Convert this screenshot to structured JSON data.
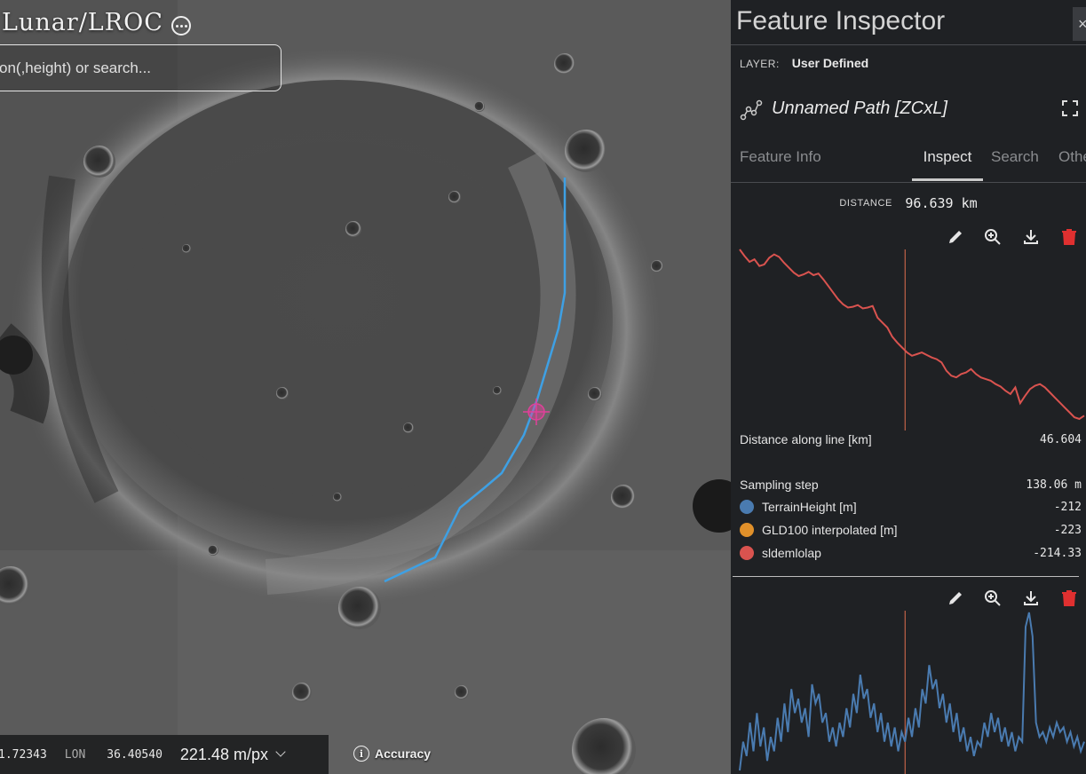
{
  "map": {
    "app_title": "Lunar/LROC",
    "search_placeholder": "on(,height) or search...",
    "lat_value": "1.72343",
    "lon_label": "LON",
    "lon_value": "36.40540",
    "scale": "221.48 m/px",
    "accuracy_label": "Accuracy",
    "path_color": "#3ea0e4",
    "marker_color": "#e0409a"
  },
  "panel": {
    "title": "Feature Inspector",
    "close_label": "×",
    "layer_key": "LAYER:",
    "layer_value": "User Defined",
    "feature_name": "Unnamed Path [ZCxL]",
    "tabs": [
      "Feature Info",
      "Inspect",
      "Search",
      "Othe"
    ],
    "active_tab": "Inspect",
    "distance_key": "DISTANCE",
    "distance_value": "96.639 km",
    "along_label": "Distance along line [km]",
    "along_value": "46.604",
    "sampling_label": "Sampling step",
    "sampling_value": "138.06 m",
    "legend": [
      {
        "label": "TerrainHeight [m]",
        "value": "-212",
        "color": "#4a7bb0"
      },
      {
        "label": "GLD100 interpolated [m]",
        "value": "-223",
        "color": "#e0902a"
      },
      {
        "label": "sldemlolap",
        "value": "-214.33",
        "color": "#d9534f"
      }
    ]
  },
  "chart_data": [
    {
      "type": "line",
      "series": [
        {
          "name": "sldemlolap",
          "color": "#d9534f",
          "values": [
            -120,
            -128,
            -135,
            -132,
            -140,
            -138,
            -130,
            -126,
            -129,
            -136,
            -142,
            -148,
            -152,
            -150,
            -147,
            -151,
            -149,
            -156,
            -164,
            -172,
            -180,
            -186,
            -190,
            -189,
            -187,
            -191,
            -190,
            -188,
            -202,
            -208,
            -214,
            -225,
            -232,
            -238,
            -244,
            -248,
            -246,
            -244,
            -247,
            -250,
            -252,
            -256,
            -266,
            -272,
            -274,
            -270,
            -268,
            -264,
            -270,
            -274,
            -276,
            -278,
            -282,
            -285,
            -290,
            -294,
            -286,
            -305,
            -296,
            -288,
            -284,
            -282,
            -286,
            -292,
            -298,
            -304,
            -310,
            -316,
            -322,
            -324,
            -320
          ]
        }
      ],
      "cursor_position_fraction": 0.48
    },
    {
      "type": "line",
      "series": [
        {
          "name": "TerrainHeight [m]",
          "color": "#4a7bb0",
          "values": [
            10,
            40,
            25,
            60,
            30,
            70,
            35,
            55,
            20,
            45,
            30,
            65,
            40,
            80,
            50,
            95,
            70,
            85,
            60,
            75,
            45,
            100,
            80,
            90,
            60,
            70,
            40,
            55,
            35,
            60,
            45,
            75,
            55,
            90,
            70,
            110,
            85,
            95,
            65,
            80,
            50,
            70,
            40,
            60,
            35,
            55,
            30,
            50,
            40,
            65,
            45,
            75,
            55,
            95,
            80,
            120,
            95,
            105,
            75,
            90,
            60,
            80,
            50,
            70,
            40,
            55,
            30,
            45,
            25,
            40,
            35,
            60,
            45,
            70,
            50,
            65,
            40,
            55,
            35,
            50,
            30,
            45,
            40,
            160,
            175,
            150,
            60,
            45,
            50,
            40,
            55,
            45,
            60,
            50,
            55,
            40,
            50,
            35,
            45,
            30,
            40
          ]
        }
      ],
      "cursor_position_fraction": 0.48
    }
  ]
}
